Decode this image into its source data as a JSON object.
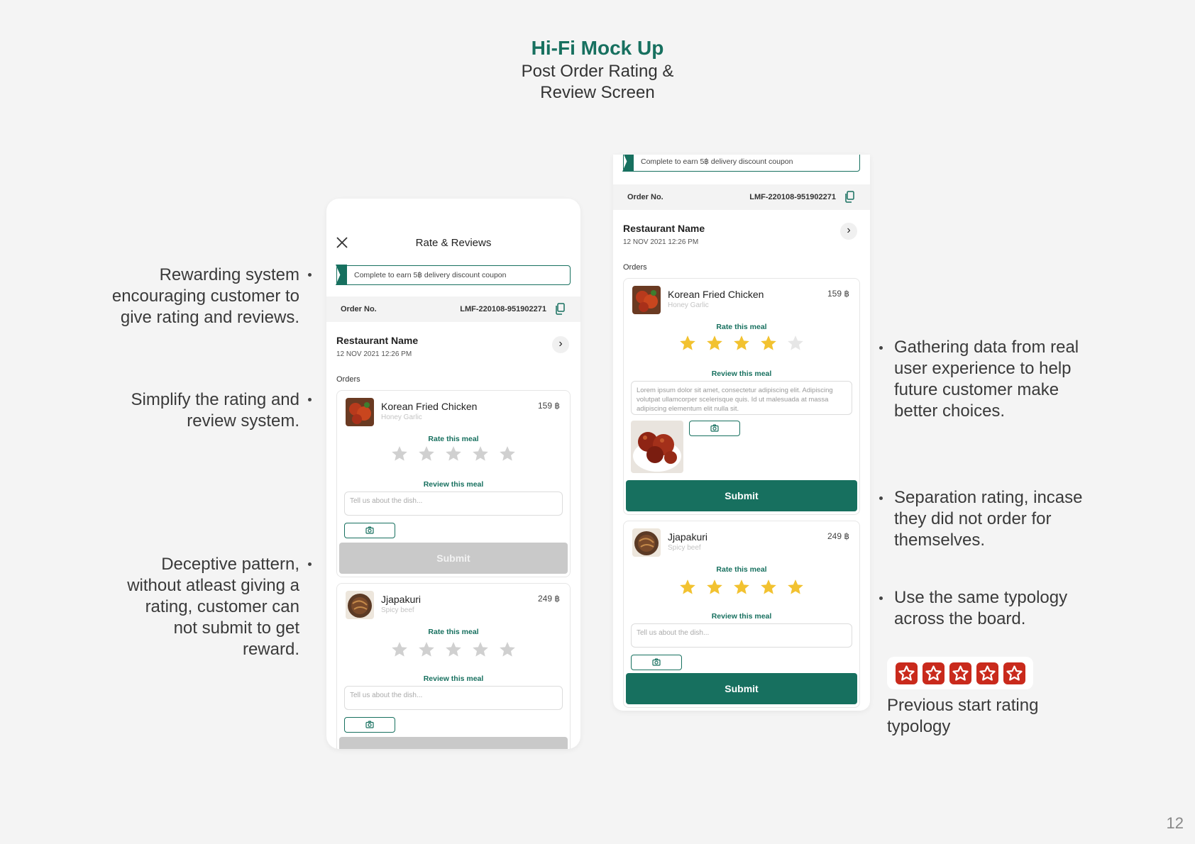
{
  "header": {
    "title": "Hi-Fi Mock Up",
    "subtitle_line1": "Post Order Rating &",
    "subtitle_line2": "Review Screen"
  },
  "notes_left": [
    {
      "lines": [
        "Rewarding system",
        "encouraging customer to",
        "give rating and reviews."
      ]
    },
    {
      "lines": [
        "Simplify the rating and",
        "review system."
      ]
    },
    {
      "lines": [
        "Deceptive pattern,",
        "without atleast giving a",
        "rating, customer can",
        "not submit to get",
        "reward."
      ]
    }
  ],
  "notes_right": [
    {
      "lines": [
        "Gathering data from real",
        "user experience to help",
        "future customer make",
        "better choices."
      ]
    },
    {
      "lines": [
        "Separation rating, incase",
        "they did not order for",
        "themselves."
      ]
    },
    {
      "lines": [
        "Use the same typology",
        "across the board."
      ]
    }
  ],
  "previous_rating": {
    "caption_line1": "Previous start rating",
    "caption_line2": "typology"
  },
  "page_number": "12",
  "screen_common": {
    "screen_title": "Rate & Reviews",
    "coupon_text": "Complete to earn 5฿ delivery discount coupon",
    "order_label": "Order No.",
    "order_number": "LMF-220108-951902271",
    "restaurant_name": "Restaurant Name",
    "order_date": "12 NOV 2021 12:26 PM",
    "orders_label": "Orders",
    "rate_label": "Rate this meal",
    "review_label": "Review this meal",
    "review_placeholder": "Tell us about the dish...",
    "submit_label": "Submit"
  },
  "items": [
    {
      "name": "Korean Fried Chicken",
      "variant": "Honey Garlic",
      "price": "159 ฿"
    },
    {
      "name": "Jjapakuri",
      "variant": "Spicy beef",
      "price": "249 ฿"
    }
  ],
  "screen2": {
    "review_text": "Lorem ipsum dolor sit amet, consectetur adipiscing elit. Adipiscing volutpat ullamcorper scelerisque quis. Id ut malesuada at massa adipiscing elementum elit nulla sit.",
    "item1_rating": 4,
    "item2_rating": 5
  },
  "colors": {
    "brand": "#17705f",
    "star_filled": "#f2c230",
    "star_empty": "#d0d0d0",
    "previous_star": "#c92a1c"
  }
}
